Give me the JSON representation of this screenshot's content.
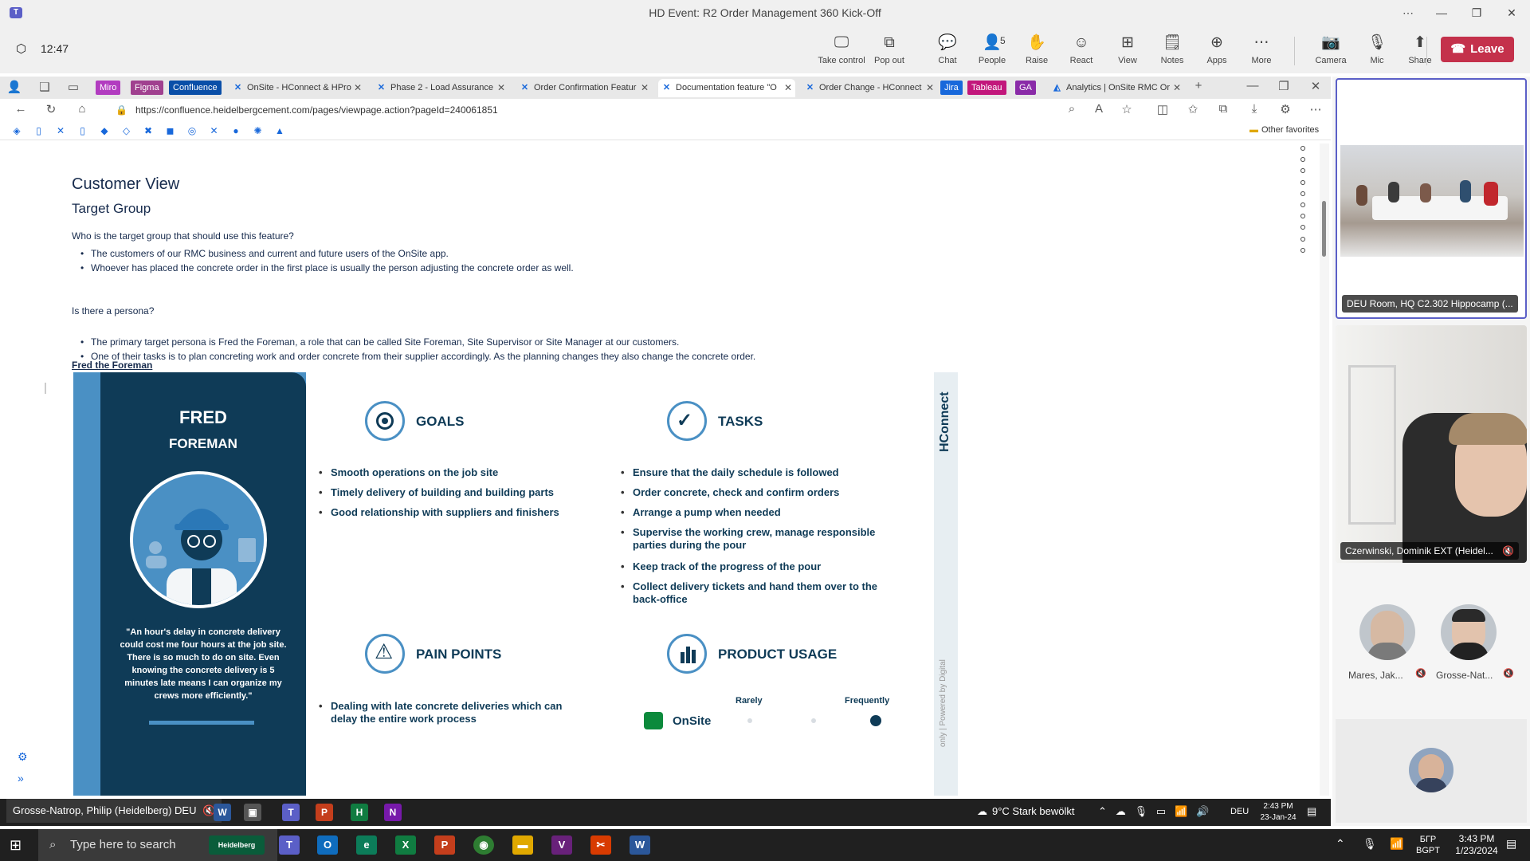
{
  "teams": {
    "title": "HD Event: R2 Order Management 360 Kick-Off",
    "time": "12:47",
    "tools": [
      {
        "label": "Take control",
        "icon": "take-control-icon",
        "glyph": "🖵"
      },
      {
        "label": "Pop out",
        "icon": "pop-out-icon",
        "glyph": "⧉"
      },
      {
        "label": "Chat",
        "icon": "chat-icon",
        "glyph": "💬"
      },
      {
        "label": "People",
        "icon": "people-icon",
        "glyph": "👤"
      },
      {
        "label": "Raise",
        "icon": "raise-hand-icon",
        "glyph": "✋"
      },
      {
        "label": "React",
        "icon": "react-icon",
        "glyph": "☺"
      },
      {
        "label": "View",
        "icon": "view-icon",
        "glyph": "⊞"
      },
      {
        "label": "Notes",
        "icon": "notes-icon",
        "glyph": "🗒"
      },
      {
        "label": "Apps",
        "icon": "apps-icon",
        "glyph": "⊕"
      },
      {
        "label": "More",
        "icon": "more-icon",
        "glyph": "⋯"
      },
      {
        "label": "Camera",
        "icon": "camera-off-icon",
        "glyph": "📷"
      },
      {
        "label": "Mic",
        "icon": "mic-off-icon",
        "glyph": "🎙"
      },
      {
        "label": "Share",
        "icon": "share-icon",
        "glyph": "⬆"
      }
    ],
    "people_count": "5",
    "leave_label": "Leave"
  },
  "browser": {
    "tabs": [
      {
        "label": "OnSite - HConnect & HPro",
        "icon": "confluence-icon"
      },
      {
        "label": "Phase 2 - Load Assurance",
        "icon": "confluence-icon"
      },
      {
        "label": "Order Confirmation Featur",
        "icon": "confluence-icon"
      },
      {
        "label": "Documentation feature \"O",
        "icon": "confluence-icon"
      },
      {
        "label": "Order Change - HConnect",
        "icon": "confluence-icon"
      },
      {
        "label": "Analytics | OnSite RMC Or",
        "icon": "analytics-icon"
      }
    ],
    "pills": [
      {
        "label": "Miro",
        "color": "#b23cc0"
      },
      {
        "label": "Figma",
        "color": "#a0408f"
      },
      {
        "label": "Confluence",
        "color": "#0a4fa8"
      },
      {
        "label": "Jira",
        "color": "#1868db"
      },
      {
        "label": "Tableau",
        "color": "#c2177c"
      },
      {
        "label": "GA",
        "color": "#8a2ba8"
      }
    ],
    "url": "https://confluence.heidelbergcement.com/pages/viewpage.action?pageId=240061851",
    "other_favorites": "Other favorites"
  },
  "page": {
    "h1": "Customer View",
    "h2": "Target Group",
    "q1": "Who is the target group that should use this feature?",
    "bullets1": [
      "The customers of our RMC business and current and future users of the OnSite app.",
      "Whoever has placed the concrete order in the first place is usually the person adjusting the concrete order as well."
    ],
    "q2": "Is there a persona?",
    "bullets2": [
      "The primary target persona is Fred the Foreman, a role that can be called Site Foreman, Site Supervisor or Site Manager at our customers.",
      "One of their tasks is to plan concreting work and order concrete from their supplier accordingly. As the planning changes they also change the concrete order."
    ],
    "fred_link": "Fred the Foreman"
  },
  "persona": {
    "name1": "FRED",
    "name2": "FOREMAN",
    "quote": "\"An hour's delay in concrete delivery could cost me four hours at the job site. There is so much to do on site. Even knowing the concrete delivery is 5 minutes late means I can organize my crews more efficiently.\"",
    "goals_title": "GOALS",
    "goals": [
      "Smooth operations on the job site",
      "Timely delivery of building and building parts",
      "Good relationship with suppliers and finishers"
    ],
    "tasks_title": "TASKS",
    "tasks": [
      "Ensure that the daily schedule is followed",
      "Order concrete, check and confirm orders",
      "Arrange a pump when needed",
      "Supervise the working crew, manage responsible parties during the pour",
      "Keep track of the progress of the pour",
      "Collect delivery tickets and hand them over to the back-office"
    ],
    "pain_title": "PAIN POINTS",
    "pains": [
      "Dealing with late concrete deliveries which can delay the entire work process"
    ],
    "usage_title": "PRODUCT USAGE",
    "usage_rarely": "Rarely",
    "usage_frequently": "Frequently",
    "usage_app": "OnSite",
    "hconnect": "HConnect",
    "powered": "only | Powered by Digital"
  },
  "participants": {
    "room_label": "DEU Room, HQ C2.302 Hippocamp (...",
    "dominik_label": "Czerwinski, Dominik EXT (Heidel...",
    "small": [
      {
        "name": "Mares, Jak..."
      },
      {
        "name": "Grosse-Nat..."
      }
    ]
  },
  "remote_taskbar": {
    "presenter": "Grosse-Natrop, Philip (Heidelberg) DEU",
    "weather": "9°C  Stark bewölkt",
    "lang": "DEU",
    "time": "2:43 PM",
    "date": "23-Jan-24"
  },
  "taskbar": {
    "search_placeholder": "Type here to search",
    "lang1": "БГР",
    "lang2": "BGPT",
    "time": "3:43 PM",
    "date": "1/23/2024"
  }
}
